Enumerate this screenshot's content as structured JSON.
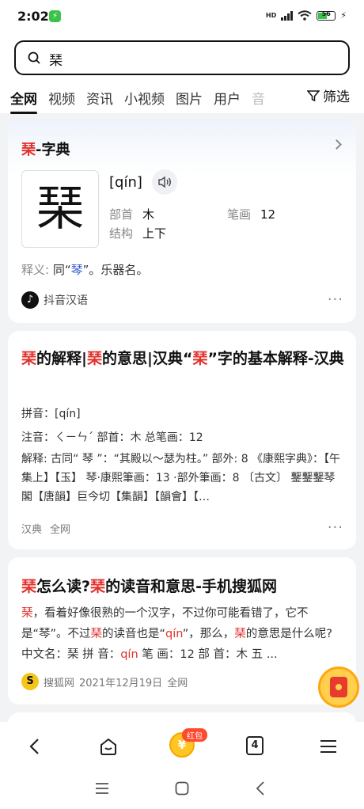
{
  "status": {
    "time": "2:02",
    "network": "HD",
    "battery": "56"
  },
  "search": {
    "query": "琹"
  },
  "tabs": [
    "全网",
    "视频",
    "资讯",
    "小视频",
    "图片",
    "用户",
    "音"
  ],
  "filter_label": "筛选",
  "dict_card": {
    "title_char": "琹",
    "title_rest": "-字典",
    "char": "琹",
    "pinyin": "[qín]",
    "radical_label": "部首",
    "radical": "木",
    "strokes_label": "笔画",
    "strokes": "12",
    "structure_label": "结构",
    "structure": "上下",
    "def_label": "释义:",
    "def_pre": "同“",
    "def_char": "琴",
    "def_post": "”。乐器名。",
    "source": "抖音汉语",
    "source_icon": "douyin-logo"
  },
  "result1": {
    "title_parts": [
      "琹",
      "的解释|",
      "琹",
      "的意思|汉典“",
      "琹",
      "”字的基本解释-汉典"
    ],
    "pinyin_line": "拼音：[qín]",
    "zhuyin_line": "注音：ㄑㄧㄣˊ  部首：木  总笔画：12",
    "explain": "解释: 古同“ 琴 ”：“其殿以～瑟为柱。” 部外: 8 《康熙字典》：【午集上】【玉】 琴·康熙筆画：13 ·部外筆画：8 〔古文〕 鑋鑋鑋琴閣【唐韻】巨今切【集韻】【韻會】【…",
    "tags": [
      "汉典",
      "全网"
    ]
  },
  "result2": {
    "title_parts": [
      "琹",
      "怎么读?",
      "琹",
      "的读音和意思-手机搜狐网"
    ],
    "p_parts": [
      "琹",
      "，看着好像很熟的一个汉字，不过你可能看错了，它不是“琴”。不过",
      "琹",
      "的读音也是“",
      "qín",
      "”，那么，",
      "琹",
      "的意思是什么呢? 中文名：琹 拼 音：",
      "qín",
      " 笔 画：12 部 首：木 五 ..."
    ],
    "source": "搜狐网",
    "date": "2021年12月19日",
    "scope": "全网"
  },
  "bottom": {
    "redpack_label": "红包",
    "coin_symbol": "¥",
    "tab_count": "4"
  }
}
